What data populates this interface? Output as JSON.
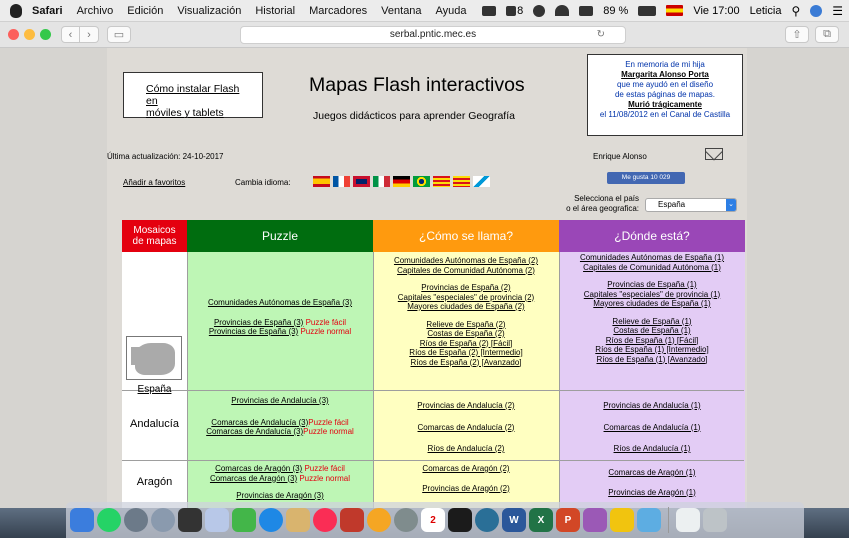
{
  "menubar": {
    "app": "Safari",
    "items": [
      "Archivo",
      "Edición",
      "Visualización",
      "Historial",
      "Marcadores",
      "Ventana",
      "Ayuda"
    ],
    "battery": "89 %",
    "clock": "Vie 17:00",
    "user": "Leticia",
    "input_code": "8"
  },
  "browser": {
    "url": "serbal.pntic.mec.es"
  },
  "page": {
    "flash_link_1": "Cómo instalar Flash en",
    "flash_link_2": "móviles y tablets",
    "title": "Mapas Flash interactivos",
    "subtitle": "Juegos didácticos para aprender Geografía",
    "memoria": {
      "line1": "En memoria de mi hija",
      "name": "Margarita Alonso Porta",
      "line2": "que me ayudó en el diseño",
      "line3": "de estas páginas de mapas.",
      "line4": "Murió trágicamente",
      "line5": "el 11/08/2012 en el Canal de Castilla"
    },
    "update": "Última actualización: 24-10-2017",
    "favorites": "Añadir a favoritos",
    "language_label": "Cambia idioma:",
    "author": "Enrique Alonso",
    "like": "Me gusta 10 029",
    "select_label_1": "Selecciona el país",
    "select_label_2": "o el área geografica:",
    "select_value": "España"
  },
  "table": {
    "headers": {
      "mosaicos_1": "Mosaicos",
      "mosaicos_2": "de mapas",
      "puzzle": "Puzzle",
      "como": "¿Cómo se llama?",
      "donde": "¿Dónde está?"
    },
    "espana": {
      "name": "España",
      "puzzle": {
        "l1": "Comunidades Autónomas de España (3)",
        "l2": "Provincias de España (3)",
        "l2b": "Puzzle fácil",
        "l3": "Provincias de España (3)",
        "l3b": "Puzzle normal"
      },
      "como": [
        "Comunidades Autónomas de España (2)",
        "Capitales de Comunidad Autónoma (2)",
        "Provincias de España (2)",
        "Capitales \"especiales\" de provincia (2)",
        "Mayores ciudades de España (2)",
        "Relieve de España (2)",
        "Costas de España (2)",
        "Ríos de España (2) [Fácil]",
        "Ríos de España (2) [Intermedio]",
        "Ríos de España (2) [Avanzado]"
      ],
      "donde": [
        "Comunidades Autónomas de España (1)",
        "Capitales de Comunidad Autónoma (1)",
        "Provincias de España (1)",
        "Capitales \"especiales\" de provincia (1)",
        "Mayores ciudades de España (1)",
        "Relieve de España (1)",
        "Costas de España (1)",
        "Ríos de España (1) [Fácil]",
        "Ríos de España (1) [Intermedio]",
        "Ríos de España (1) [Avanzado]"
      ]
    },
    "andalucia": {
      "name": "Andalucía",
      "puzzle": {
        "l1": "Provincias de Andalucía (3)",
        "l2": "Comarcas de Andalucía (3)",
        "l2b": "Puzzle fácil",
        "l3": "Comarcas de Andalucía (3)",
        "l3b": "Puzzle normal"
      },
      "como": [
        "Provincias de Andalucía (2)",
        "Comarcas de Andalucía (2)",
        "Ríos de Andalucía (2)"
      ],
      "donde": [
        "Provincias de Andalucía (1)",
        "Comarcas de Andalucía (1)",
        "Ríos de Andalucía (1)"
      ]
    },
    "aragon": {
      "name": "Aragón",
      "puzzle": {
        "l1": "Comarcas de Aragón (3)",
        "l1b": "Puzzle fácil",
        "l2": "Comarcas de Aragón (3)",
        "l2b": "Puzzle normal",
        "l3": "Provincias de Aragón (3)"
      },
      "como": [
        "Comarcas de Aragón (2)",
        "Provincias de Aragón (2)"
      ],
      "donde": [
        "Comarcas de Aragón (1)",
        "Provincias de Aragón (1)"
      ]
    }
  },
  "dock": {
    "word_letter": "W",
    "excel_letter": "X",
    "ppt_letter": "P",
    "calendar_day": "2"
  }
}
